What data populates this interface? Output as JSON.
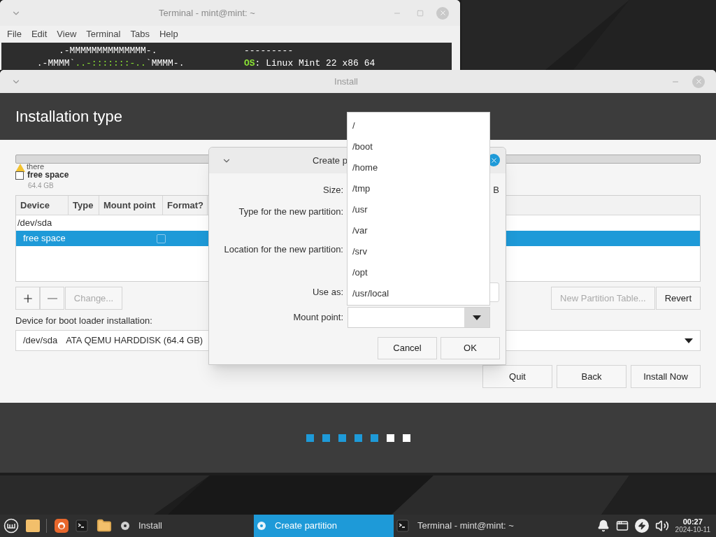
{
  "terminal": {
    "title": "Terminal - mint@mint: ~",
    "menu": [
      "File",
      "Edit",
      "View",
      "Terminal",
      "Tabs",
      "Help"
    ],
    "lines": [
      {
        "art": [
          {
            "text": "          .-MMMMMMMMMMMMMM-.",
            "color": "#ffffff"
          }
        ],
        "info": [
          {
            "text": "---------",
            "color": "#ffffff"
          }
        ]
      },
      {
        "art": [
          {
            "text": "      .-MMMM`",
            "color": "#ffffff"
          },
          {
            "text": "..-:::::::-..",
            "color": "#8ae234"
          },
          {
            "text": "`MMMM-.",
            "color": "#ffffff"
          }
        ],
        "info": [
          {
            "text": "OS",
            "color": "#8ae234"
          },
          {
            "text": ": Linux Mint 22 x86 64",
            "color": "#ffffff"
          }
        ]
      }
    ]
  },
  "installer": {
    "title": "Install",
    "heading": "Installation type",
    "legend": {
      "warning": "there",
      "label": "free space",
      "size": "64.4 GB"
    },
    "table": {
      "columns": [
        "Device",
        "Type",
        "Mount point",
        "Format?"
      ],
      "rows": [
        {
          "kind": "device",
          "device": "/dev/sda",
          "selected": false
        },
        {
          "kind": "partition",
          "device": "free space",
          "selected": true,
          "format": false
        }
      ]
    },
    "edit_buttons": [
      {
        "kind": "add",
        "disabled": false
      },
      {
        "kind": "remove",
        "disabled": true
      },
      {
        "kind": "text",
        "label": "Change...",
        "disabled": true
      }
    ],
    "table_buttons": [
      {
        "label": "New Partition Table...",
        "disabled": true
      },
      {
        "label": "Revert",
        "disabled": false
      }
    ],
    "bootloader_label": "Device for boot loader installation:",
    "bootloader": {
      "device": "/dev/sda",
      "model": "ATA QEMU HARDDISK (64.4 GB)"
    },
    "buttons": [
      "Quit",
      "Back",
      "Install Now"
    ],
    "steps": [
      {
        "done": true
      },
      {
        "done": true
      },
      {
        "done": true
      },
      {
        "done": true
      },
      {
        "done": true
      },
      {
        "done": false
      },
      {
        "done": false
      }
    ]
  },
  "dialog": {
    "title": "Create p",
    "labels": {
      "size": "Size:",
      "type": "Type for the new partition:",
      "location": "Location for the new partition:",
      "use_as": "Use as:",
      "mount": "Mount point:"
    },
    "size_unit": "B",
    "buttons": [
      "Cancel",
      "OK"
    ]
  },
  "mount_options": [
    {
      "label": "/",
      "selected": false
    },
    {
      "label": "/boot",
      "selected": false
    },
    {
      "label": "/home",
      "selected": false
    },
    {
      "label": "/tmp",
      "selected": false
    },
    {
      "label": "/usr",
      "selected": false
    },
    {
      "label": "/var",
      "selected": false
    },
    {
      "label": "/srv",
      "selected": false
    },
    {
      "label": "/opt",
      "selected": false
    },
    {
      "label": "/usr/local",
      "selected": false
    }
  ],
  "taskbar": {
    "windows": [
      {
        "kind": "disc",
        "label": "Install",
        "selected": false
      },
      {
        "kind": "disc",
        "label": "Create partition",
        "selected": true
      },
      {
        "kind": "terminal",
        "label": "Terminal - mint@mint: ~",
        "selected": false
      }
    ],
    "time": "00:27",
    "date": "2024-10-11"
  }
}
